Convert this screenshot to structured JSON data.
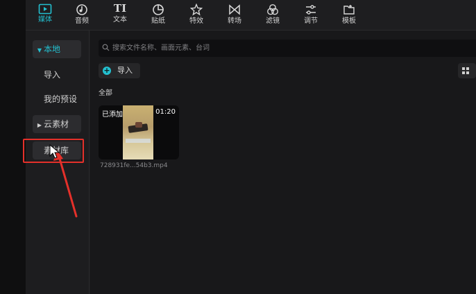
{
  "toolbar": {
    "items": [
      {
        "label": "媒体",
        "icon": "media-icon",
        "active": true
      },
      {
        "label": "音频",
        "icon": "audio-icon"
      },
      {
        "label": "文本",
        "icon": "text-icon"
      },
      {
        "label": "贴纸",
        "icon": "sticker-icon"
      },
      {
        "label": "特效",
        "icon": "effects-icon"
      },
      {
        "label": "转场",
        "icon": "transition-icon"
      },
      {
        "label": "滤镜",
        "icon": "filter-icon"
      },
      {
        "label": "调节",
        "icon": "adjust-icon"
      },
      {
        "label": "模板",
        "icon": "template-icon"
      }
    ],
    "text_glyph": "TI"
  },
  "sidebar": {
    "local": "本地",
    "import": "导入",
    "presets": "我的预设",
    "cloud": "云素材",
    "library": "素材库"
  },
  "main": {
    "search_placeholder": "搜索文件名称、画面元素、台词",
    "import_label": "导入",
    "section": "全部",
    "card": {
      "added_badge": "已添加",
      "duration": "01:20",
      "filename": "728931fe...54b3.mp4"
    }
  },
  "colors": {
    "accent": "#23c0d0",
    "annotation": "#e5302a"
  }
}
